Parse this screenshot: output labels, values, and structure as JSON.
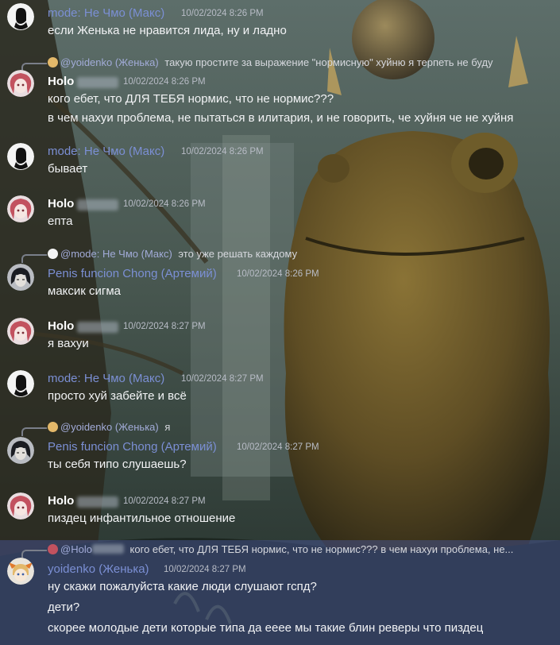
{
  "messages": [
    {
      "avatar": "eye",
      "name": "mode: Не Чмо (Макс)",
      "time": "10/02/2024 8:26 PM",
      "lines": [
        "если Женька не нравится лида, ну и ладно"
      ]
    },
    {
      "avatar": "holo",
      "reply_user": "@yoidenko (Женька)",
      "reply_text": "такую простите за выражение \"нормисную\" хуйню я терпеть не буду",
      "name": "Holo",
      "time": "10/02/2024 8:26 PM",
      "lines": [
        "кого ебет, что ДЛЯ ТЕБЯ нормис, что не нормис???",
        "в чем нахуи проблема, не пытаться в илитария, и не говорить, че хуйня че не хуйня"
      ]
    },
    {
      "avatar": "eye",
      "name": "mode: Не Чмо (Макс)",
      "time": "10/02/2024 8:26 PM",
      "lines": [
        "бывает"
      ]
    },
    {
      "avatar": "holo",
      "name": "Holo",
      "time": "10/02/2024 8:26 PM",
      "lines": [
        "епта"
      ]
    },
    {
      "avatar": "chong",
      "reply_user": "@mode: Не Чмо (Макс)",
      "reply_text": "это уже решать каждому",
      "name": "Penis funcion Chong (Артемий)",
      "time": "10/02/2024 8:26 PM",
      "lines": [
        "максик сигма"
      ]
    },
    {
      "avatar": "holo",
      "name": "Holo",
      "time": "10/02/2024 8:27 PM",
      "lines": [
        "я вахуи"
      ]
    },
    {
      "avatar": "eye",
      "name": "mode: Не Чмо (Макс)",
      "time": "10/02/2024 8:27 PM",
      "lines": [
        "просто хуй забейте и всё"
      ]
    },
    {
      "avatar": "chong",
      "reply_user": "@yoidenko (Женька)",
      "reply_text": "я",
      "name": "Penis funcion Chong (Артемий)",
      "time": "10/02/2024 8:27 PM",
      "lines": [
        "ты себя типо слушаешь?"
      ]
    },
    {
      "avatar": "holo",
      "name": "Holo",
      "time": "10/02/2024 8:27 PM",
      "lines": [
        "пиздец инфантильное отношение"
      ]
    },
    {
      "avatar": "yoidenko",
      "reply_user": "@Holo",
      "reply_text": "кого ебет, что ДЛЯ ТЕБЯ нормис, что не нормис??? в чем нахуи проблема, не...",
      "name": "yoidenko (Женька)",
      "time": "10/02/2024 8:27 PM",
      "lines": [
        "ну скажи пожалуйста какие люди слушают гспд?",
        "дети?",
        "скорее молодые дети которые типа да ееее мы такие блин реверы что пиздец"
      ]
    }
  ]
}
